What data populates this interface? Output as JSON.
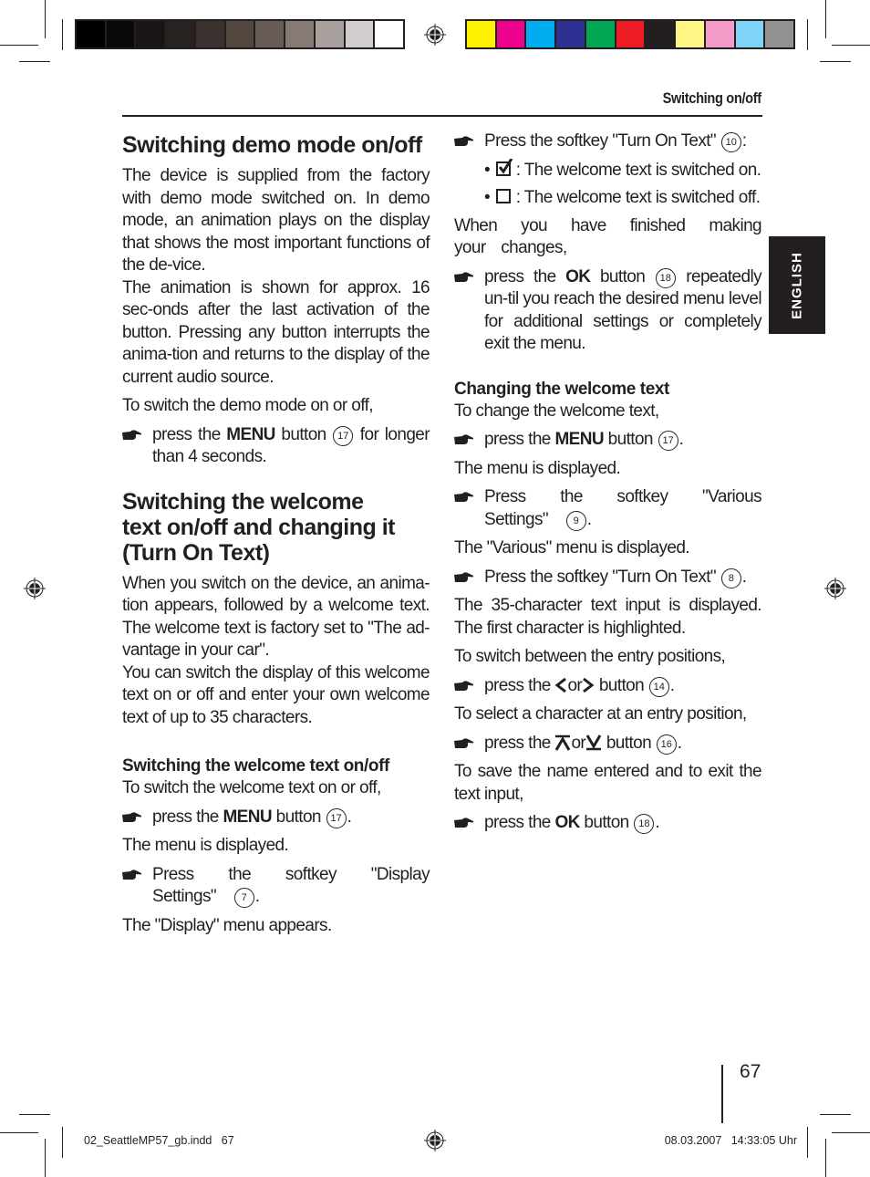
{
  "print_marks": {
    "gray_swatches": [
      "#000000",
      "#0b0908",
      "#191515",
      "#272220",
      "#3b3230",
      "#52473f",
      "#675c58",
      "#857a74",
      "#a8a09c",
      "#d3cccc",
      "#ffffff"
    ],
    "color_swatches": [
      "#fff200",
      "#ec008c",
      "#00aeef",
      "#2e3192",
      "#00a651",
      "#ed1c24",
      "#231f20",
      "#fff685",
      "#f49ac9",
      "#7fd3f7",
      "#939292"
    ]
  },
  "header": {
    "running_head": "Switching on/off",
    "language_tab": "ENGLISH"
  },
  "left_column": {
    "section1": {
      "title": "Switching demo mode on/off",
      "para1": "The device is supplied from the factory with demo mode switched on. In demo mode, an animation plays on the display that shows the most important functions of the de-vice.",
      "para2": "The animation is shown for approx. 16 sec-onds after the last activation of the button. Pressing any button interrupts the anima-tion and returns to the display of the current audio source.",
      "intro": "To switch the demo mode on or off,",
      "step1": {
        "pre": "press the ",
        "bold": "MENU",
        "mid": " button ",
        "num": "17",
        "post": " for longer than 4 seconds."
      }
    },
    "section2": {
      "title_line1": "Switching the welcome",
      "title_line2": "text on/off and changing it",
      "title_line3": "(Turn On Text)",
      "para1": "When you switch on the device, an anima-tion appears, followed by a welcome text. The welcome text is factory set to \"The ad-vantage in your car\".",
      "para2": "You can switch the display of this welcome text on or off and enter your own welcome text of up to 35 characters."
    },
    "subsection": {
      "title": "Switching the welcome text on/off",
      "intro": "To switch the welcome text on or off,",
      "step1": {
        "pre": "press the ",
        "bold": "MENU",
        "mid": " button ",
        "num": "17",
        "post": "."
      },
      "after1": "The menu is displayed.",
      "step2": {
        "pre": "Press the softkey \"Display Settings\" ",
        "num": "7",
        "post": "."
      },
      "after2": "The \"Display\" menu appears."
    }
  },
  "right_column": {
    "step1": {
      "pre": "Press the softkey \"Turn On Text\" ",
      "num": "10",
      "post": ":"
    },
    "bullet_on": ": The welcome text is switched on.",
    "bullet_off": ": The welcome text is switched off.",
    "finished": "When you have finished making your changes,",
    "step2": {
      "pre": "press the ",
      "bold": "OK",
      "mid": " button ",
      "num": "18",
      "post": " repeatedly un-til you reach the desired menu level for additional settings or completely exit the menu."
    },
    "changing": {
      "title": "Changing the welcome text",
      "intro": "To change the welcome text,",
      "step1": {
        "pre": "press the ",
        "bold": "MENU",
        "mid": " button ",
        "num": "17",
        "post": "."
      },
      "after1": "The menu is displayed.",
      "step2": {
        "pre": "Press the softkey \"Various Settings\" ",
        "num": "9",
        "post": "."
      },
      "after2": "The \"Various\" menu is displayed.",
      "step3": {
        "pre": "Press the softkey \"Turn On Text\" ",
        "num": "8",
        "post": "."
      },
      "after3": "The 35-character text input is displayed. The first character is highlighted.",
      "intro2": "To switch between the entry positions,",
      "step4": {
        "pre": "press the ",
        "or": "or",
        "mid": "button ",
        "num": "14",
        "post": "."
      },
      "intro3": "To select a character at an entry position,",
      "step5": {
        "pre": "press the ",
        "or": "or",
        "mid": "button ",
        "num": "16",
        "post": "."
      },
      "intro4": "To save the name entered and to exit the text input,",
      "step6": {
        "pre": "press the ",
        "bold": "OK",
        "mid": " button ",
        "num": "18",
        "post": "."
      }
    }
  },
  "footer": {
    "page_number": "67",
    "slug_left": "02_SeattleMP57_gb.indd   67",
    "slug_right": "08.03.2007   14:33:05 Uhr"
  }
}
